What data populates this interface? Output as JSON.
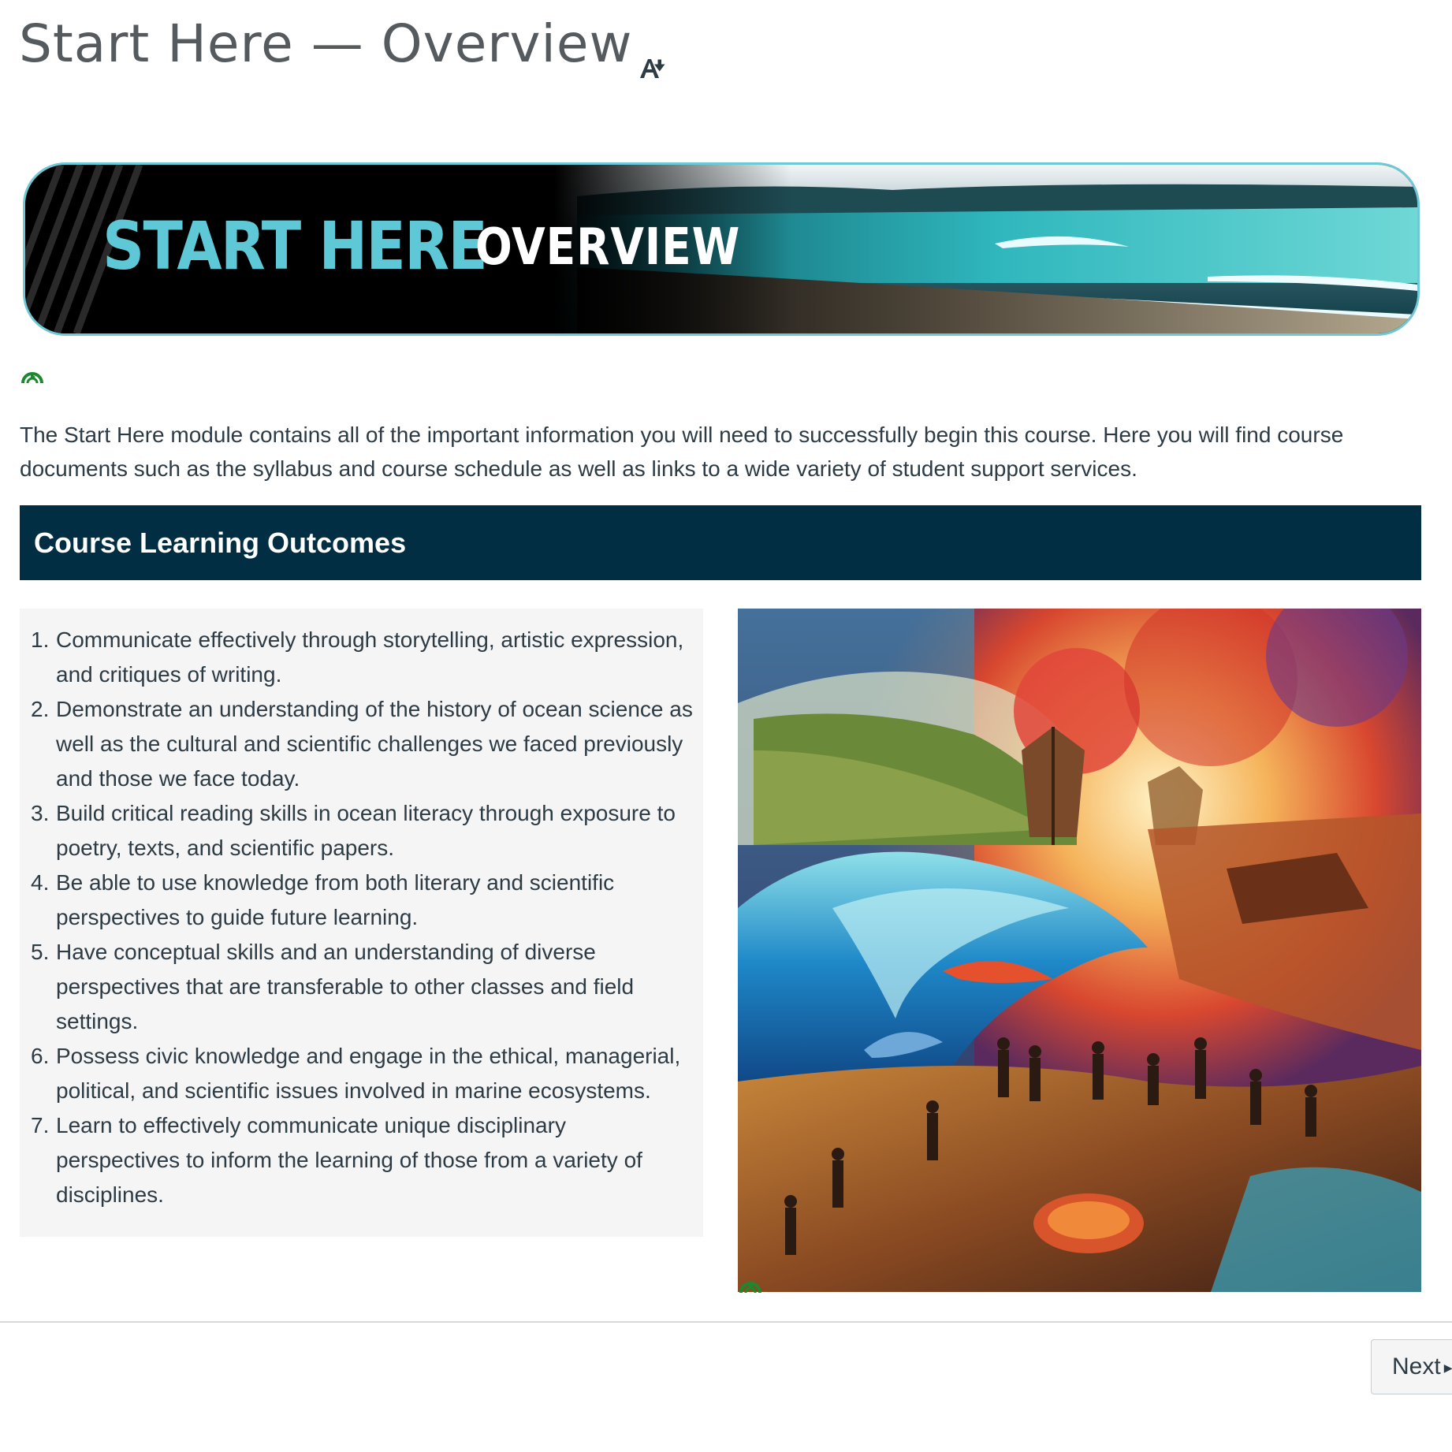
{
  "page": {
    "title": "Start Here — Overview"
  },
  "icons": {
    "title_accessibility": "accessibility-text-icon",
    "content_status": "green-refresh-status-icon"
  },
  "banner": {
    "word1": "START HERE",
    "word2": "OVERVIEW",
    "colors": {
      "accent": "#5fc8d6",
      "background": "#000000",
      "border": "#6ec8d6"
    }
  },
  "intro": {
    "text": "The Start Here module contains all of the important information you will need to successfully begin this course. Here you will find course documents such as the syllabus and course schedule as well as links to a wide variety of student support services."
  },
  "outcomes": {
    "heading": "Course Learning Outcomes",
    "heading_bg": "#012e42",
    "items": [
      {
        "num": "1.",
        "text": "Communicate effectively through storytelling, artistic expression, and critiques of writing."
      },
      {
        "num": "2.",
        "text": "Demonstrate an understanding of the history of ocean science as well as the cultural and scientific challenges we faced previously and those we face today."
      },
      {
        "num": "3.",
        "text": "Build critical reading skills in ocean literacy through exposure to poetry, texts, and scientific papers."
      },
      {
        "num": "4.",
        "text": "Be able to use knowledge from both literary and scientific perspectives to guide future learning."
      },
      {
        "num": "5.",
        "text": "Have conceptual skills and an understanding of diverse perspectives that are transferable to other classes and field settings."
      },
      {
        "num": "6.",
        "text": "Possess civic knowledge and engage in the ethical, managerial, political, and scientific issues involved in marine ecosystems."
      },
      {
        "num": "7.",
        "text": "Learn to effectively communicate unique disciplinary perspectives to inform the learning of those from a variety of disciplines."
      }
    ]
  },
  "navigation": {
    "next_label": "Next"
  }
}
